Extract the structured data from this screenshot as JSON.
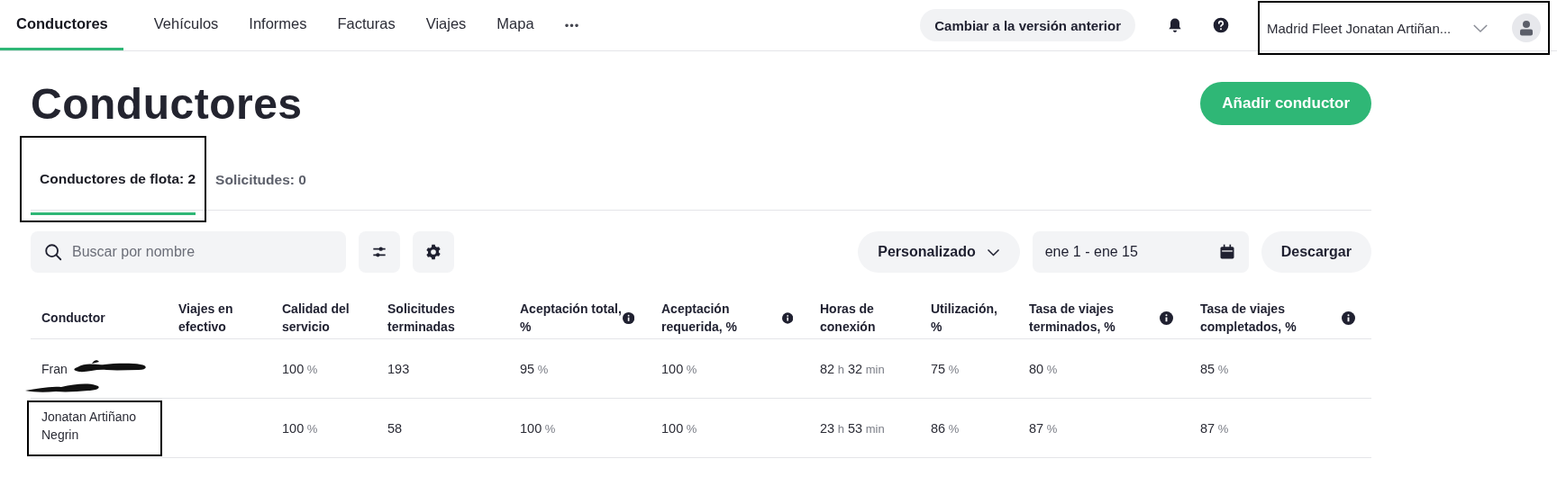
{
  "nav": {
    "items": [
      {
        "label": "Conductores",
        "selected": true
      },
      {
        "label": "Vehículos",
        "selected": false
      },
      {
        "label": "Informes",
        "selected": false
      },
      {
        "label": "Facturas",
        "selected": false
      },
      {
        "label": "Viajes",
        "selected": false
      },
      {
        "label": "Mapa",
        "selected": false
      }
    ],
    "more": "•••",
    "switch_button": "Cambiar a la versión anterior",
    "account": {
      "name": "Madrid Fleet Jonatan Artiñan...",
      "highlighted": true
    }
  },
  "title": "Conductores",
  "add_button": "Añadir conductor",
  "tabs": [
    {
      "label": "Conductores de flota: 2",
      "selected": true,
      "highlighted": true
    },
    {
      "label": "Solicitudes: 0",
      "selected": false,
      "highlighted": false
    }
  ],
  "search": {
    "placeholder": "Buscar por nombre"
  },
  "period": "Personalizado",
  "date_range": "ene 1 - ene 15",
  "download_button": "Descargar",
  "table": {
    "columns": [
      {
        "label": "Conductor",
        "info": false
      },
      {
        "label": "Viajes en efectivo",
        "info": false
      },
      {
        "label": "Calidad del servicio",
        "info": false
      },
      {
        "label": "Solicitudes terminadas",
        "info": false
      },
      {
        "label": "Aceptación total, %",
        "info": true
      },
      {
        "label": "Aceptación requerida, %",
        "info": true
      },
      {
        "label": "Horas de conexión",
        "info": false
      },
      {
        "label": "Utilización, %",
        "info": false
      },
      {
        "label": "Tasa de viajes terminados, %",
        "info": true
      },
      {
        "label": "Tasa de viajes completados, %",
        "info": true
      }
    ],
    "rows": [
      {
        "redacted": true,
        "highlighted": false,
        "cells": [
          "Fran",
          "",
          "100 %",
          "193",
          "95 %",
          "100 %",
          "82 h 32 min",
          "75 %",
          "80 %",
          "85 %"
        ]
      },
      {
        "redacted": false,
        "highlighted": true,
        "cells": [
          "Jonatan Artiñano Negrin",
          "",
          "100 %",
          "58",
          "100 %",
          "100 %",
          "23 h 53 min",
          "86 %",
          "87 %",
          "87 %"
        ]
      }
    ]
  }
}
